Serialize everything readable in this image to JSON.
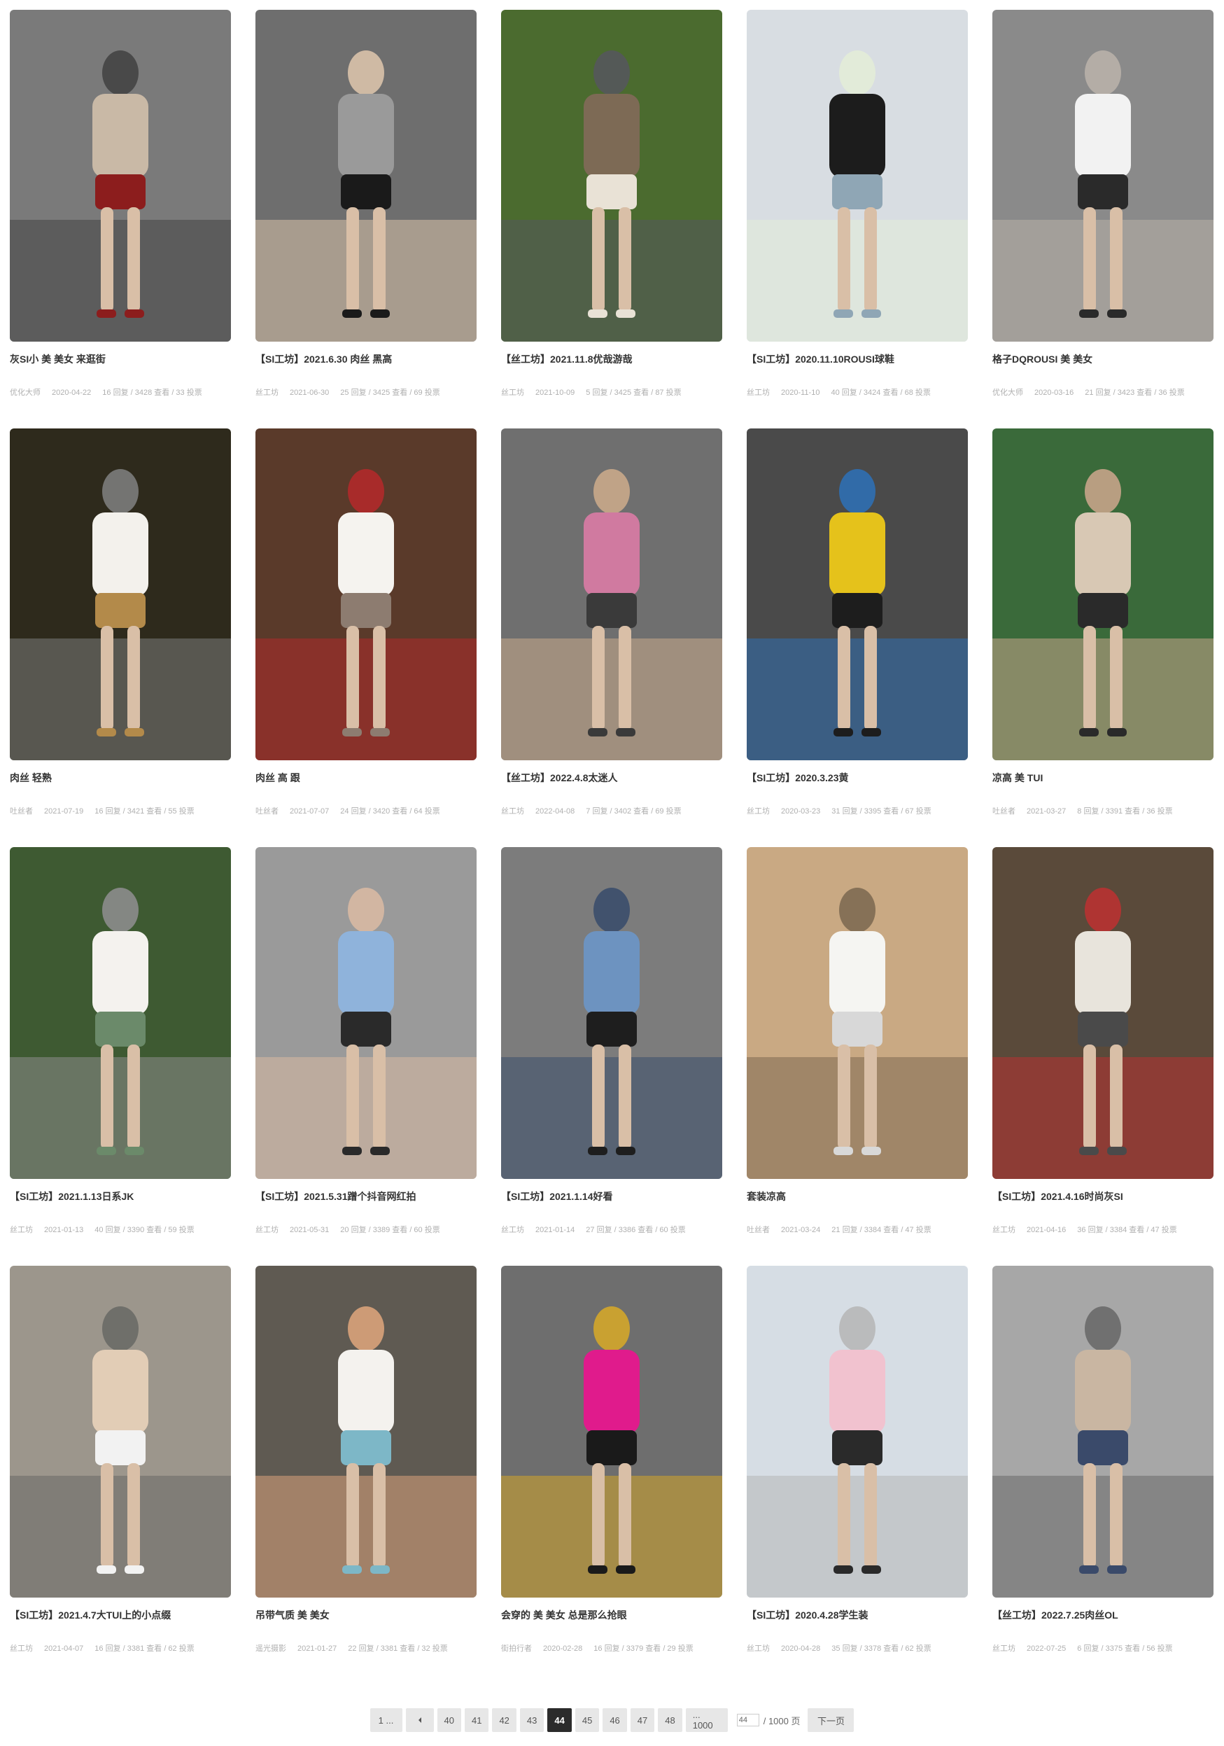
{
  "colors": {
    "active_page_bg": "#2b2b2b",
    "page_bg": "#e7e7e7",
    "meta_text": "#b0b0b0",
    "title_text": "#333333"
  },
  "posts": [
    {
      "title": "灰SI小 美 美女 来逛街",
      "author": "优化大师",
      "date": "2020-04-22",
      "stats": "16 回复 / 3428 查看 / 33 投票",
      "palette": [
        "#7a7a7a",
        "#c9b9a6",
        "#8c1d1d",
        "#444444"
      ]
    },
    {
      "title": "【SI工坊】2021.6.30 肉丝 黑高",
      "author": "丝工坊",
      "date": "2021-06-30",
      "stats": "25 回复 / 3425 查看 / 69 投票",
      "palette": [
        "#6e6e6e",
        "#9a9a9a",
        "#1a1a1a",
        "#d9c2aa"
      ]
    },
    {
      "title": "【丝工坊】2021.11.8优哉游哉",
      "author": "丝工坊",
      "date": "2021-10-09",
      "stats": "5 回复 / 3425 查看 / 87 投票",
      "palette": [
        "#4b6b2f",
        "#7d6a55",
        "#e9e2d6",
        "#55585c"
      ]
    },
    {
      "title": "【SI工坊】2020.11.10ROUSI球鞋",
      "author": "丝工坊",
      "date": "2020-11-10",
      "stats": "40 回复 / 3424 查看 / 68 投票",
      "palette": [
        "#d8dde2",
        "#1c1c1c",
        "#8fa6b5",
        "#e3ecd8"
      ]
    },
    {
      "title": "格子DQROUSI 美 美女",
      "author": "优化大师",
      "date": "2020-03-16",
      "stats": "21 回复 / 3423 查看 / 36 投票",
      "palette": [
        "#8a8a8a",
        "#f2f2f2",
        "#2a2a2a",
        "#b8b0a8"
      ]
    },
    {
      "title": "肉丝 轻熟",
      "author": "吐丝者",
      "date": "2021-07-19",
      "stats": "16 回复 / 3421 查看 / 55 投票",
      "palette": [
        "#2e2a1c",
        "#f3f1ec",
        "#b38a4a",
        "#7c7c7c"
      ]
    },
    {
      "title": "肉丝 高 跟",
      "author": "吐丝者",
      "date": "2021-07-07",
      "stats": "24 回复 / 3420 查看 / 64 投票",
      "palette": [
        "#5a3a2a",
        "#f5f3ef",
        "#8d7c70",
        "#b02a2a"
      ]
    },
    {
      "title": "【丝工坊】2022.4.8太迷人",
      "author": "丝工坊",
      "date": "2022-04-08",
      "stats": "7 回复 / 3402 查看 / 69 投票",
      "palette": [
        "#6f6f6f",
        "#d07aa0",
        "#3a3a3a",
        "#c9a98a"
      ]
    },
    {
      "title": "【SI工坊】2020.3.23黄",
      "author": "丝工坊",
      "date": "2020-03-23",
      "stats": "31 回复 / 3395 查看 / 67 投票",
      "palette": [
        "#4a4a4a",
        "#e5c21b",
        "#1d1d1d",
        "#2f6fb3"
      ]
    },
    {
      "title": "凉高 美 TUI",
      "author": "吐丝者",
      "date": "2021-03-27",
      "stats": "8 回复 / 3391 查看 / 36 投票",
      "palette": [
        "#3a6a3a",
        "#d8c8b4",
        "#2a2a2a",
        "#c7a48a"
      ]
    },
    {
      "title": "【SI工坊】2021.1.13日系JK",
      "author": "丝工坊",
      "date": "2021-01-13",
      "stats": "40 回复 / 3390 查看 / 59 投票",
      "palette": [
        "#3e5a32",
        "#f4f2ee",
        "#6b8a6a",
        "#8c8c8c"
      ]
    },
    {
      "title": "【SI工坊】2021.5.31蹭个抖音网红拍",
      "author": "丝工坊",
      "date": "2021-05-31",
      "stats": "20 回复 / 3389 查看 / 60 投票",
      "palette": [
        "#9a9a9a",
        "#8fb3db",
        "#2a2a2a",
        "#d8b9a3"
      ]
    },
    {
      "title": "【SI工坊】2021.1.14好看",
      "author": "丝工坊",
      "date": "2021-01-14",
      "stats": "27 回复 / 3386 查看 / 60 投票",
      "palette": [
        "#7c7c7c",
        "#6d93c0",
        "#1e1e1e",
        "#3b4e6c"
      ]
    },
    {
      "title": "套装凉高",
      "author": "吐丝者",
      "date": "2021-03-24",
      "stats": "21 回复 / 3384 查看 / 47 投票",
      "palette": [
        "#c9a983",
        "#f5f5f2",
        "#d8d8d8",
        "#7e6a52"
      ]
    },
    {
      "title": "【SI工坊】2021.4.16时尚灰SI",
      "author": "丝工坊",
      "date": "2021-04-16",
      "stats": "36 回复 / 3384 查看 / 47 投票",
      "palette": [
        "#5a4a3a",
        "#e8e4dc",
        "#4a4a4a",
        "#b83232"
      ]
    },
    {
      "title": "【SI工坊】2021.4.7大TUI上的小点缀",
      "author": "丝工坊",
      "date": "2021-04-07",
      "stats": "16 回复 / 3381 查看 / 62 投票",
      "palette": [
        "#9c968c",
        "#e2cdb6",
        "#f2f2f2",
        "#6a6a66"
      ]
    },
    {
      "title": "吊带气质 美 美女",
      "author": "遥光摄影",
      "date": "2021-01-27",
      "stats": "22 回复 / 3381 查看 / 32 投票",
      "palette": [
        "#5f5a52",
        "#f4f2ee",
        "#7db7c7",
        "#d9a27a"
      ]
    },
    {
      "title": "会穿的 美 美女 总是那么抢眼",
      "author": "街拍行者",
      "date": "2020-02-28",
      "stats": "16 回复 / 3379 查看 / 29 投票",
      "palette": [
        "#6e6e6e",
        "#e01b8c",
        "#1a1a1a",
        "#d3a62a"
      ]
    },
    {
      "title": "【SI工坊】2020.4.28学生装",
      "author": "丝工坊",
      "date": "2020-04-28",
      "stats": "35 回复 / 3378 查看 / 62 投票",
      "palette": [
        "#d6dde4",
        "#f1c2cf",
        "#2a2a2a",
        "#b7b7b7"
      ]
    },
    {
      "title": "【丝工坊】2022.7.25肉丝OL",
      "author": "丝工坊",
      "date": "2022-07-25",
      "stats": "6 回复 / 3375 查看 / 56 投票",
      "palette": [
        "#a7a7a7",
        "#c9b6a2",
        "#3a4a6a",
        "#6a6a6a"
      ]
    }
  ],
  "pagination": {
    "first": "1 ...",
    "prev_icon": "chevron-left-icon",
    "pages": [
      "40",
      "41",
      "42",
      "43",
      "44",
      "45",
      "46",
      "47",
      "48"
    ],
    "current": "44",
    "last": "... 1000",
    "jump_value": "44",
    "total_label": "/ 1000 页",
    "next": "下一页"
  }
}
